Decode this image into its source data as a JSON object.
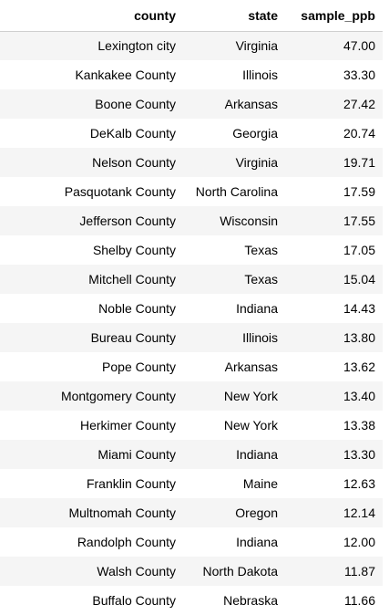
{
  "table": {
    "columns": [
      "county",
      "state",
      "sample_ppb"
    ],
    "rows": [
      [
        "Lexington city",
        "Virginia",
        "47.00"
      ],
      [
        "Kankakee County",
        "Illinois",
        "33.30"
      ],
      [
        "Boone County",
        "Arkansas",
        "27.42"
      ],
      [
        "DeKalb County",
        "Georgia",
        "20.74"
      ],
      [
        "Nelson County",
        "Virginia",
        "19.71"
      ],
      [
        "Pasquotank County",
        "North Carolina",
        "17.59"
      ],
      [
        "Jefferson County",
        "Wisconsin",
        "17.55"
      ],
      [
        "Shelby County",
        "Texas",
        "17.05"
      ],
      [
        "Mitchell County",
        "Texas",
        "15.04"
      ],
      [
        "Noble County",
        "Indiana",
        "14.43"
      ],
      [
        "Bureau County",
        "Illinois",
        "13.80"
      ],
      [
        "Pope County",
        "Arkansas",
        "13.62"
      ],
      [
        "Montgomery County",
        "New York",
        "13.40"
      ],
      [
        "Herkimer County",
        "New York",
        "13.38"
      ],
      [
        "Miami County",
        "Indiana",
        "13.30"
      ],
      [
        "Franklin County",
        "Maine",
        "12.63"
      ],
      [
        "Multnomah County",
        "Oregon",
        "12.14"
      ],
      [
        "Randolph County",
        "Indiana",
        "12.00"
      ],
      [
        "Walsh County",
        "North Dakota",
        "11.87"
      ],
      [
        "Buffalo County",
        "Nebraska",
        "11.66"
      ]
    ]
  },
  "colors": {
    "stripe": "#f5f5f5",
    "border": "#cfcfcf",
    "text": "#000000"
  }
}
